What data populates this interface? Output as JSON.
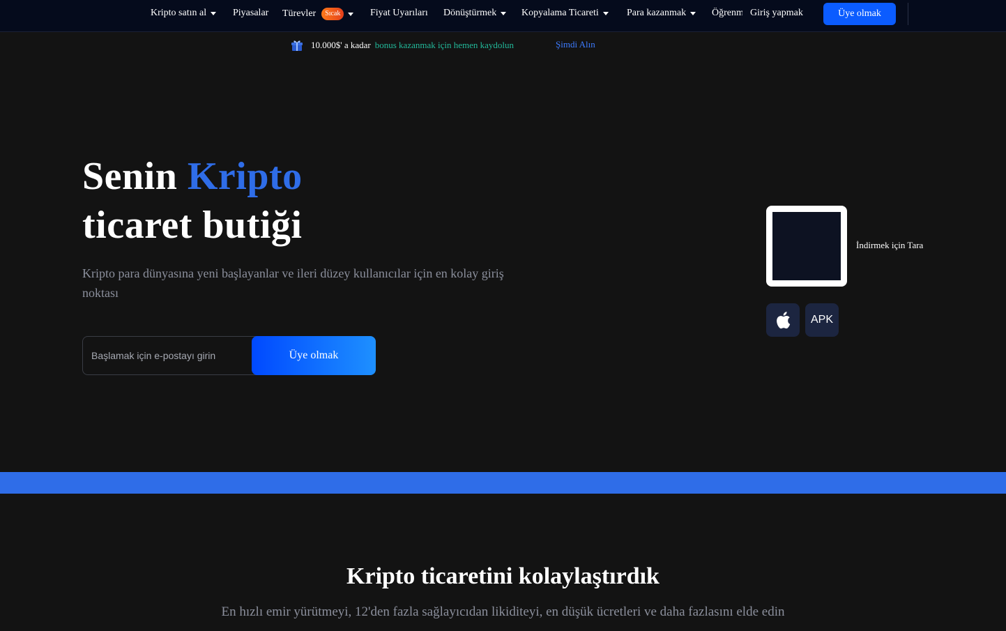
{
  "nav": {
    "items": [
      {
        "label": "Kripto satın al",
        "dropdown": true
      },
      {
        "label": "Piyasalar",
        "dropdown": false
      },
      {
        "label": "Türevler",
        "dropdown": true,
        "badge": "Sıcak"
      },
      {
        "label": "Fiyat Uyarıları",
        "dropdown": false
      },
      {
        "label": "Dönüştürmek",
        "dropdown": true
      },
      {
        "label": "Kopyalama Ticareti",
        "dropdown": true
      },
      {
        "label": "Para kazanmak",
        "dropdown": true
      },
      {
        "label": "Öğrenmek",
        "dropdown": false
      }
    ],
    "login": "Giriş yapmak",
    "signup": "Üye olmak"
  },
  "promo": {
    "amount": "10.000$' a kadar",
    "text": "bonus kazanmak için hemen kaydolun",
    "link": "Şimdi Alın"
  },
  "hero": {
    "title_1": "Senin",
    "title_accent": "Kripto",
    "title_2": "ticaret butiği",
    "subtitle": "Kripto para dünyasına yeni başlayanlar ve ileri düzey kullanıcılar için en kolay giriş noktası",
    "email_placeholder": "Başlamak için e-postayı girin",
    "signup": "Üye olmak"
  },
  "download": {
    "qr_label": "İndirmek için Tara",
    "apk_label": "APK",
    "ios_icon": "apple-icon"
  },
  "section": {
    "title": "Kripto ticaretini kolaylaştırdık",
    "subtitle": "En hızlı emir yürütmeyi, 12'den fazla sağlayıcıdan likiditeyi, en düşük ücretleri ve daha fazlasını elde edin"
  },
  "colors": {
    "accent": "#2f6de8",
    "button": "#0b5cff",
    "promo_green": "#22b99a",
    "badge": "#ff7a1a"
  }
}
